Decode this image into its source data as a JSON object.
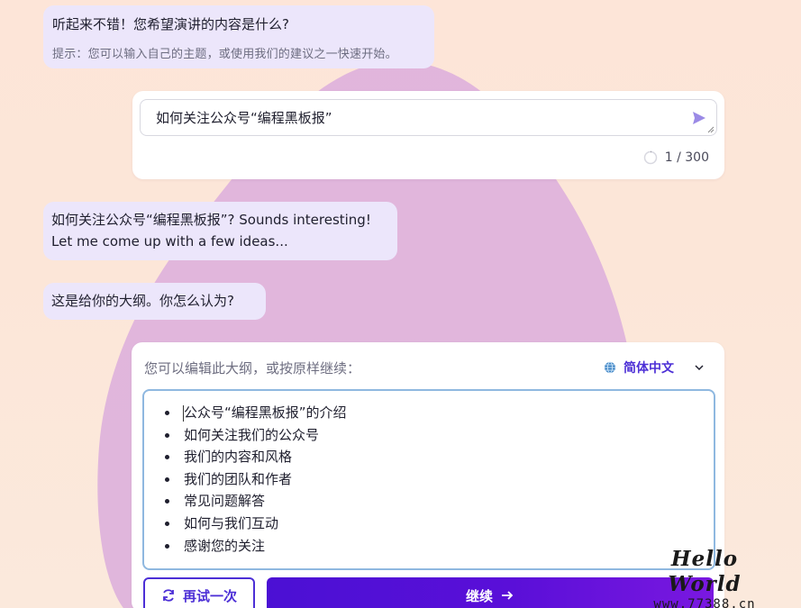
{
  "messages": {
    "greeting": "听起来不错！您希望演讲的内容是什么?",
    "hint": "提示：您可以输入自己的主题，或使用我们的建议之一快速开始。",
    "reply_line1": "如何关注公众号“编程黑板报”? Sounds interesting!",
    "reply_line2": "Let me come up with a few ideas...",
    "outline_intro": "这是给你的大纲。你怎么认为?"
  },
  "topic_input": {
    "value": "如何关注公众号“编程黑板报”",
    "counter": "1 / 300"
  },
  "outline": {
    "header": "您可以编辑此大纲，或按原样继续：",
    "language": "简体中文",
    "items": [
      "公众号“编程黑板报”的介绍",
      "如何关注我们的公众号",
      "我们的内容和风格",
      "我们的团队和作者",
      "常见问题解答",
      "如何与我们互动",
      "感谢您的关注"
    ]
  },
  "actions": {
    "retry_label": "再试一次",
    "continue_label": "继续"
  },
  "watermark": {
    "line1": "Hello World",
    "line2": "www.77388.cn"
  },
  "colors": {
    "accent": "#4c2fd6",
    "bubble": "#ece6fb",
    "blob": "#d9a8dc",
    "outline_border": "#8fb8e0"
  }
}
